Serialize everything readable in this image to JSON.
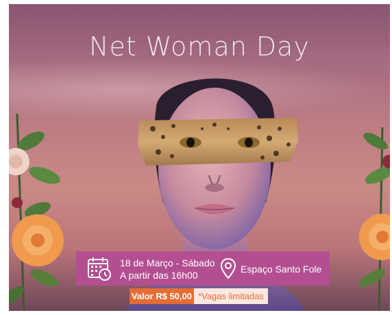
{
  "poster": {
    "title": "Net Woman Day",
    "event": {
      "date": "18 de Março - Sábado",
      "time": "A partir das 16h00",
      "venue": "Espaço Santo Fole"
    },
    "price_label": "Valor R$ 50,00",
    "note": "*Vagas limitadas"
  },
  "icons": {
    "calendar": "calendar-clock-icon",
    "location": "location-pin-icon"
  },
  "colors": {
    "background_top": "#8a5570",
    "background_mid": "#c98a85",
    "info_box": "#b34f91",
    "price_badge": "#e46d35",
    "note_badge": "#fbe8e3"
  }
}
